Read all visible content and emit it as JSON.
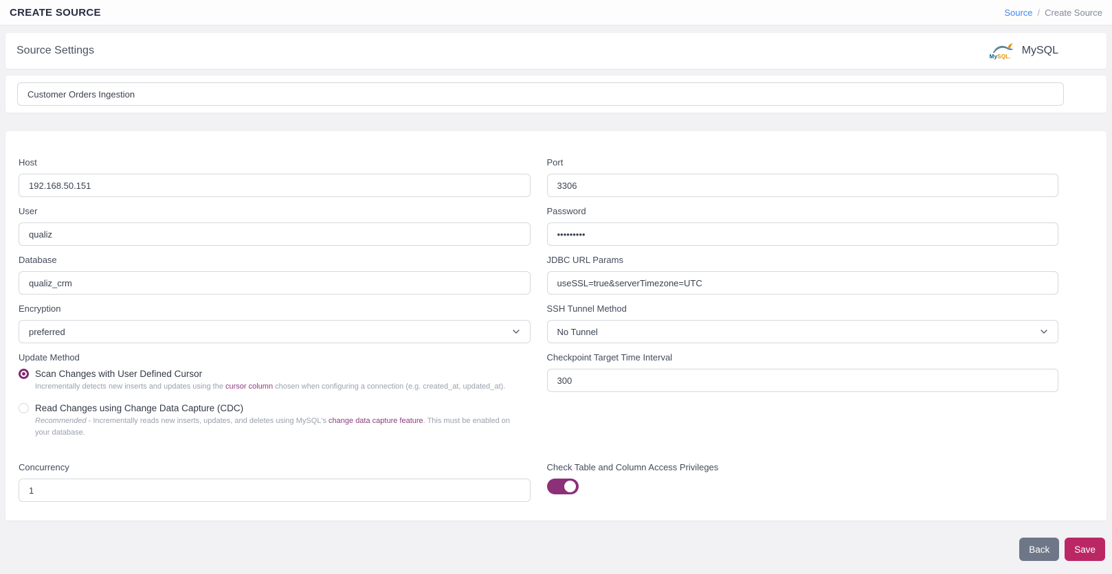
{
  "colors": {
    "accent_purple": "#7d2d6f",
    "toggle_purple": "#8c3077",
    "link_blue": "#4186f5",
    "save_button": "#bb2764",
    "back_button": "#6e7787"
  },
  "header": {
    "title": "CREATE SOURCE",
    "breadcrumb": {
      "link": "Source",
      "separator": "/",
      "current": "Create Source"
    }
  },
  "source_settings": {
    "title": "Source Settings",
    "connector_name": "MySQL",
    "logo_my": "My",
    "logo_sql": "SQL."
  },
  "name_field": {
    "value": "Customer Orders Ingestion"
  },
  "form": {
    "fields": {
      "host": {
        "label": "Host",
        "value": "192.168.50.151"
      },
      "port": {
        "label": "Port",
        "value": "3306"
      },
      "user": {
        "label": "User",
        "value": "qualiz"
      },
      "password": {
        "label": "Password",
        "value": "•••••••••"
      },
      "database": {
        "label": "Database",
        "value": "qualiz_crm"
      },
      "jdbc": {
        "label": "JDBC URL Params",
        "value": "useSSL=true&serverTimezone=UTC"
      },
      "encryption": {
        "label": "Encryption",
        "value": "preferred"
      },
      "ssh": {
        "label": "SSH Tunnel Method",
        "value": "No Tunnel"
      },
      "checkpoint": {
        "label": "Checkpoint Target Time Interval",
        "value": "300"
      },
      "concurrency": {
        "label": "Concurrency",
        "value": "1"
      }
    },
    "update_method": {
      "label": "Update Method",
      "options": [
        {
          "title": "Scan Changes with User Defined Cursor",
          "selected": true,
          "desc_before": "Incrementally detects new inserts and updates using the ",
          "desc_link": "cursor column",
          "desc_after": " chosen when configuring a connection (e.g. created_at, updated_at)."
        },
        {
          "title": "Read Changes using Change Data Capture (CDC)",
          "selected": false,
          "desc_em": "Recommended",
          "desc_before": " - Incrementally reads new inserts, updates, and deletes using MySQL's ",
          "desc_link": "change data capture feature",
          "desc_after": ". This must be enabled on your database."
        }
      ]
    },
    "privileges_toggle": {
      "label": "Check Table and Column Access Privileges",
      "on": true
    }
  },
  "footer": {
    "back_label": "Back",
    "save_label": "Save"
  }
}
